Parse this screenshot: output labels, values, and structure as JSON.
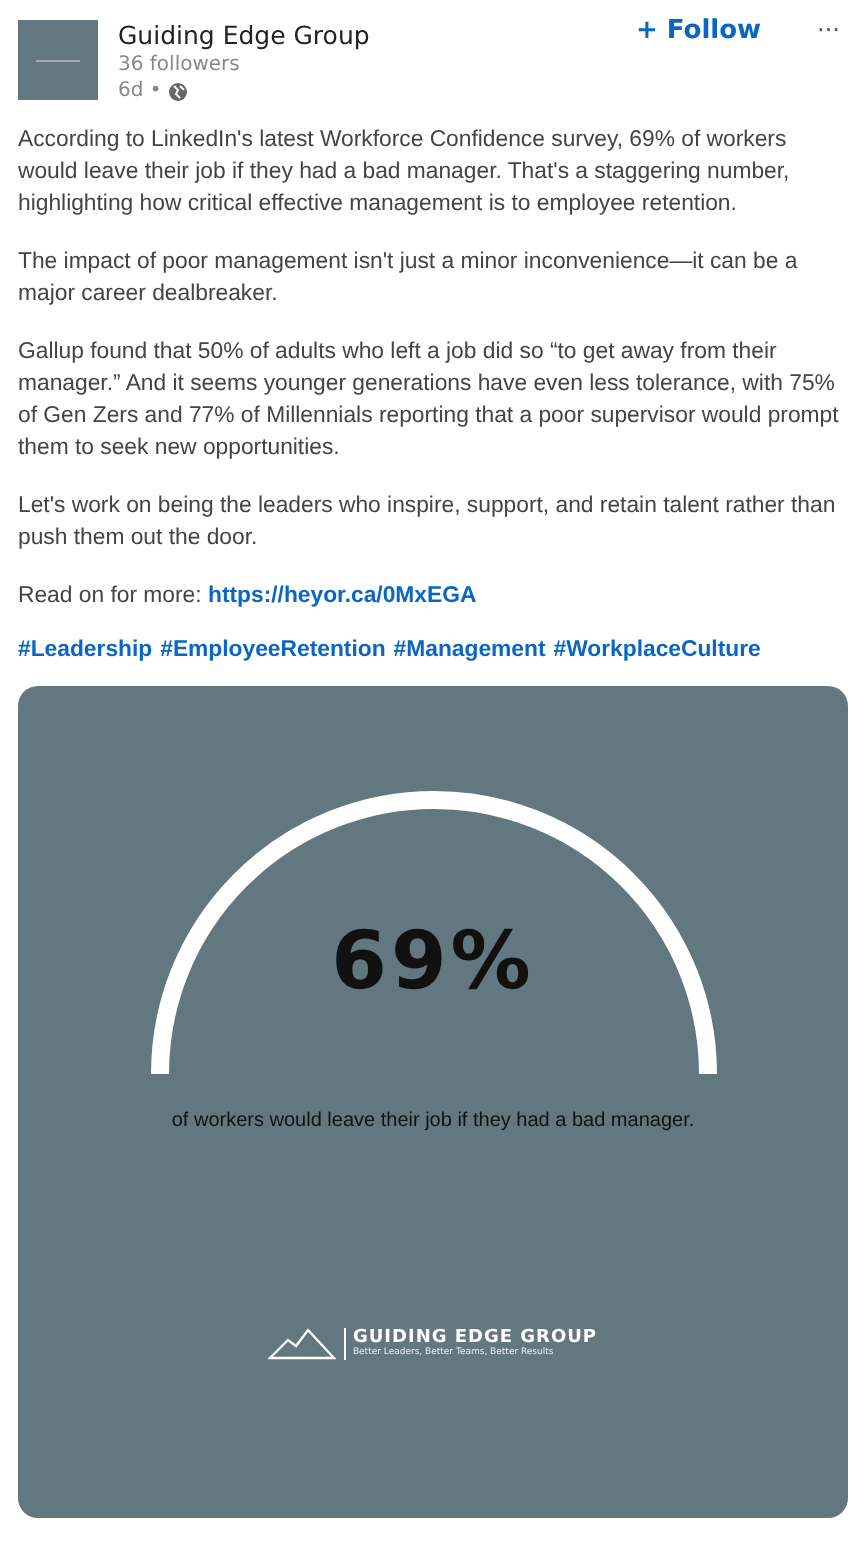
{
  "post": {
    "author": "Guiding Edge Group",
    "followers": "36 followers",
    "age": "6d •",
    "follow_button": "+ Follow",
    "menu": "···",
    "paragraphs": [
      "According to LinkedIn's latest Workforce Confidence survey, 69% of workers would leave their job if they had a bad manager. That's a staggering number, highlighting how critical effective management is to employee retention.",
      "The impact of poor management isn't just a minor inconvenience—it can be a major career dealbreaker.",
      "Gallup found that 50% of adults who left a job did so “to get away from their manager.” And it seems younger generations have even less tolerance, with 75% of Gen Zers and 77% of Millennials reporting that a poor supervisor would prompt them to seek new opportunities.",
      "Let's work on being the leaders who inspire, support, and retain talent rather than push them out the door."
    ],
    "read_more": "Read on for more:",
    "link": "https://heyor.ca/0MxEGA",
    "hashtags": [
      "#Leadership",
      "#EmployeeRetention",
      "#Management",
      "#WorkplaceCulture"
    ]
  },
  "graphic": {
    "stat": "69%",
    "caption": "of workers would leave their job if they had a bad manager.",
    "logo_name": "GUIDING EDGE GROUP",
    "logo_tagline": "Better Leaders, Better Teams, Better Results"
  }
}
